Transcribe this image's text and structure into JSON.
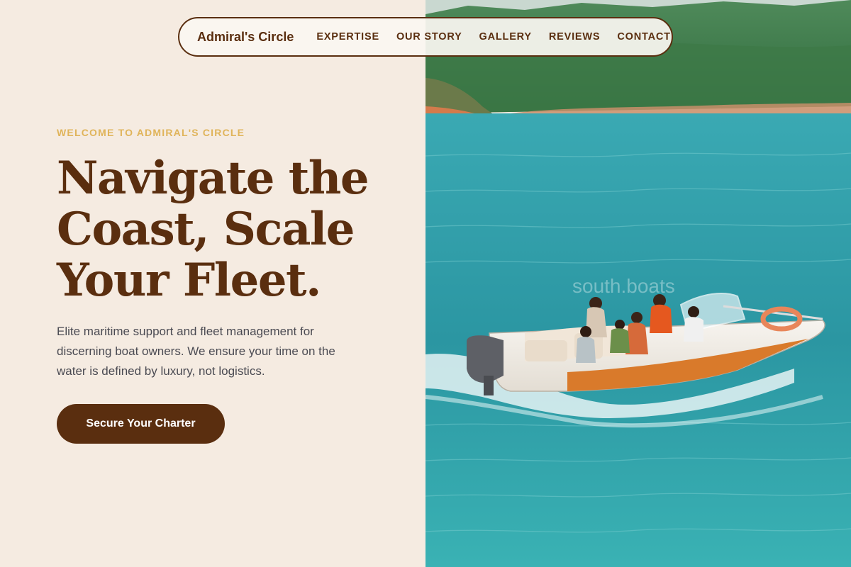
{
  "nav": {
    "brand": "Admiral's Circle",
    "links": [
      "EXPERTISE",
      "OUR STORY",
      "GALLERY",
      "REVIEWS",
      "CONTACT"
    ]
  },
  "hero": {
    "eyebrow": "WELCOME TO ADMIRAL'S CIRCLE",
    "headline_lines": [
      "Navigate the",
      "Coast, Scale",
      "Your Fleet."
    ],
    "description": "Elite maritime support and fleet management for discerning boat owners. We ensure your time on the water is defined by luxury, not logistics.",
    "cta_label": "Secure Your Charter"
  },
  "photo": {
    "watermark": "south.boats",
    "subject": "speedboat-on-lake"
  },
  "colors": {
    "brand_brown": "#5a2e0f",
    "accent_gold": "#e0b45a",
    "cream_background": "#f5ebe1",
    "water_teal": "#2e9aa6",
    "hull_orange": "#d97a2b"
  }
}
